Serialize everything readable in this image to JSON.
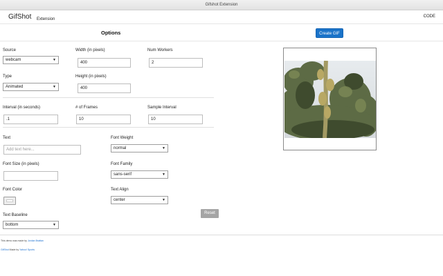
{
  "window": {
    "title": "Gifshot Extension"
  },
  "header": {
    "brand": "GifShot",
    "brand_sub": "Extension",
    "code_link": "CODE"
  },
  "toolbar": {
    "options_title": "Options",
    "create_button": "Create GIF"
  },
  "form": {
    "source": {
      "label": "Source",
      "value": "webcam"
    },
    "width": {
      "label": "Width (in pixels)",
      "value": "400"
    },
    "num_workers": {
      "label": "Num Workers",
      "value": "2"
    },
    "type": {
      "label": "Type",
      "value": "Animated"
    },
    "height": {
      "label": "Height (in pixels)",
      "value": "400"
    },
    "interval": {
      "label": "Interval (in seconds)",
      "value": ".1"
    },
    "frames": {
      "label": "# of Frames",
      "value": "10"
    },
    "sample_interval": {
      "label": "Sample Interval",
      "value": "10"
    },
    "text": {
      "label": "Text",
      "placeholder": "Add text here..."
    },
    "font_weight": {
      "label": "Font Weight",
      "value": "normal"
    },
    "font_size": {
      "label": "Font Size (in pixels)",
      "value": ""
    },
    "font_family": {
      "label": "Font Family",
      "value": "sans-serif"
    },
    "font_color": {
      "label": "Font Color"
    },
    "text_align": {
      "label": "Text Align",
      "value": "center"
    },
    "text_baseline": {
      "label": "Text Baseline",
      "value": "bottom"
    },
    "reset_button": "Reset"
  },
  "footer": {
    "line1_text": "This demo was made by",
    "line1_link": "Jordan Brattan",
    "line2_link": "GifShot",
    "line2_text": "Made by",
    "line2_link2": "Yahoo! Sports"
  },
  "icons": {
    "caret": "chevron-down-icon"
  }
}
